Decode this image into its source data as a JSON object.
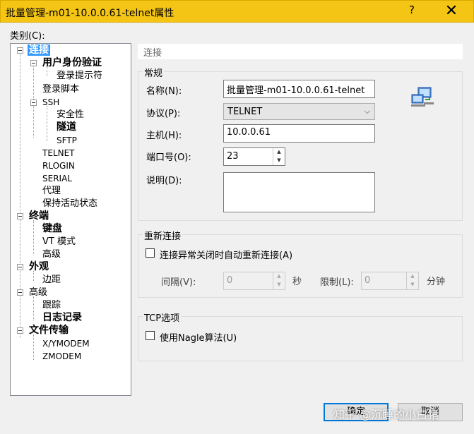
{
  "window": {
    "title": "批量管理-m01-10.0.0.61-telnet属性",
    "help": "?",
    "close": "✕"
  },
  "category_label": "类别(C):",
  "tree": {
    "connection": "连接",
    "auth": "用户身份验证",
    "login_prompt": "登录提示符",
    "login_script": "登录脚本",
    "ssh": "SSH",
    "security": "安全性",
    "tunnel": "隧道",
    "sftp": "SFTP",
    "telnet": "TELNET",
    "rlogin": "RLOGIN",
    "serial": "SERIAL",
    "proxy": "代理",
    "keepalive": "保持活动状态",
    "terminal": "终端",
    "keyboard": "键盘",
    "vt_mode": "VT 模式",
    "term_advanced": "高级",
    "appearance": "外观",
    "margin": "边距",
    "advanced": "高级",
    "trace": "跟踪",
    "log": "日志记录",
    "file_transfer": "文件传输",
    "xymodem": "X/YMODEM",
    "zmodem": "ZMODEM"
  },
  "section_header": "连接",
  "general": {
    "title": "常规",
    "name_label": "名称(N):",
    "name_value": "批量管理-m01-10.0.0.61-telnet",
    "protocol_label": "协议(P):",
    "protocol_value": "TELNET",
    "host_label": "主机(H):",
    "host_value": "10.0.0.61",
    "port_label": "端口号(O):",
    "port_value": "23",
    "desc_label": "说明(D):",
    "desc_value": ""
  },
  "reconnect": {
    "title": "重新连接",
    "checkbox_label": "连接异常关闭时自动重新连接(A)",
    "interval_label": "间隔(V):",
    "interval_value": "0",
    "interval_unit": "秒",
    "limit_label": "限制(L):",
    "limit_value": "0",
    "limit_unit": "分钟"
  },
  "tcp": {
    "title": "TCP选项",
    "nagle_label": "使用Nagle算法(U)"
  },
  "buttons": {
    "ok": "确定",
    "cancel": "取消"
  },
  "watermark": "知乎 @沉睡的小白猪",
  "icons": {
    "network": "network-computers-icon"
  }
}
